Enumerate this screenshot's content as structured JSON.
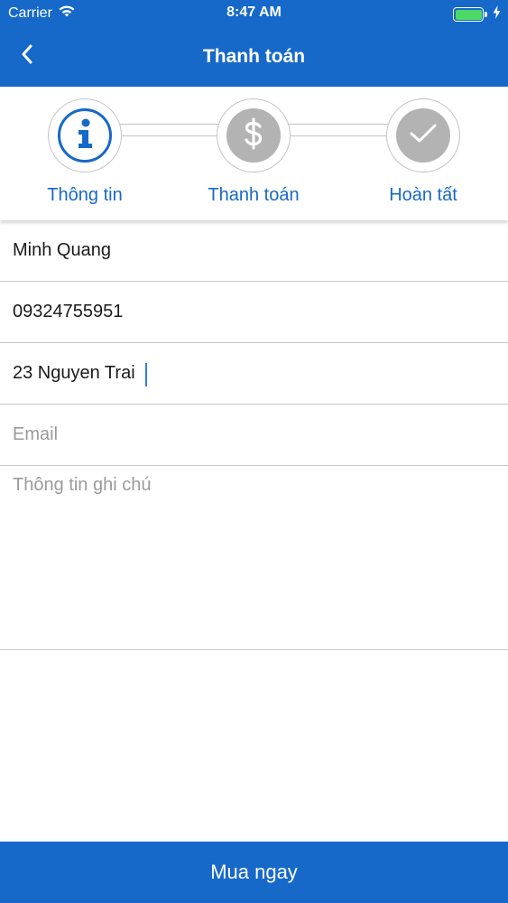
{
  "status_bar": {
    "carrier": "Carrier",
    "time": "8:47 AM",
    "battery_color": "#4cd964"
  },
  "nav": {
    "title": "Thanh toán",
    "back_icon": "chevron-left-icon"
  },
  "stepper": {
    "steps": [
      {
        "label": "Thông tin",
        "icon": "info-icon",
        "state": "active"
      },
      {
        "label": "Thanh toán",
        "icon": "dollar-icon",
        "state": "inactive"
      },
      {
        "label": "Hoàn tất",
        "icon": "checkmark-icon",
        "state": "inactive"
      }
    ]
  },
  "form": {
    "name": {
      "value": "Minh Quang",
      "placeholder": ""
    },
    "phone": {
      "value": "09324755951",
      "placeholder": ""
    },
    "address": {
      "value": "23 Nguyen Trai",
      "placeholder": ""
    },
    "email": {
      "value": "",
      "placeholder": "Email"
    },
    "notes": {
      "value": "",
      "placeholder": "Thông tin ghi chú"
    }
  },
  "buy_button": {
    "label": "Mua ngay"
  },
  "colors": {
    "accent": "#1669c9",
    "inactive_step": "#b3b3b3",
    "divider": "#c8c8c8"
  }
}
